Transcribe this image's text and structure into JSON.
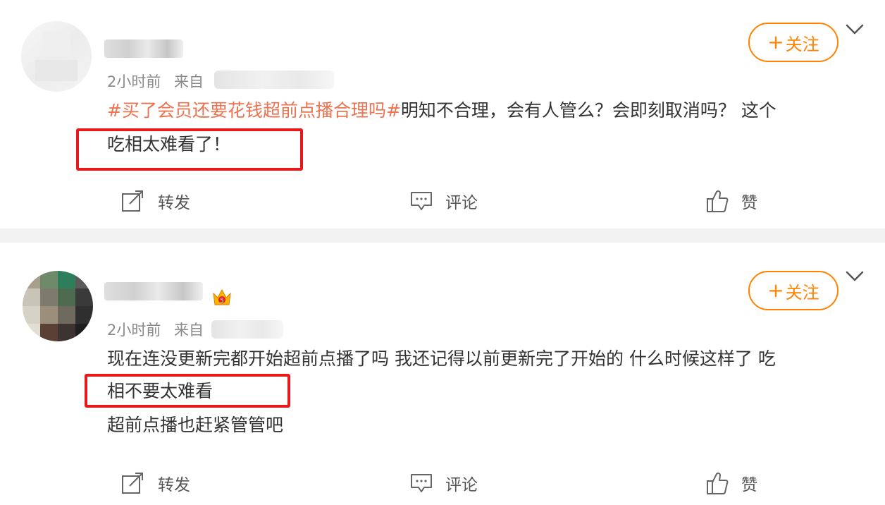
{
  "posts": [
    {
      "time": "2小时前",
      "source_prefix": "来自",
      "follow_label": "关注",
      "follow_plus": "+",
      "text_lines": [
        {
          "topic": "#买了会员还要花钱超前点播合理吗#",
          "text": "明知不合理，会有人管么？会即刻取消吗？ 这个"
        },
        {
          "topic": "",
          "text": "吃相太难看了！"
        }
      ],
      "actions": {
        "repost": "转发",
        "comment": "评论",
        "like": "赞"
      }
    },
    {
      "time": "2小时前",
      "source_prefix": "来自",
      "follow_label": "关注",
      "follow_plus": "+",
      "text_lines": [
        {
          "topic": "",
          "text": "现在连没更新完都开始超前点播了吗 我还记得以前更新完了开始的 什么时候这样了 吃"
        },
        {
          "topic": "",
          "text": "相不要太难看"
        },
        {
          "topic": "",
          "text": "超前点播也赶紧管管吧"
        }
      ],
      "actions": {
        "repost": "转发",
        "comment": "评论",
        "like": "赞"
      }
    }
  ],
  "icons": {
    "repost": "repost-icon",
    "comment": "comment-icon",
    "like": "thumbs-up-icon",
    "menu": "chevron-down-icon",
    "badge": "crown-icon"
  },
  "colors": {
    "accent": "#ff8200",
    "topic": "#eb7350",
    "highlight": "#e8191d",
    "meta": "#8a8a8a"
  }
}
